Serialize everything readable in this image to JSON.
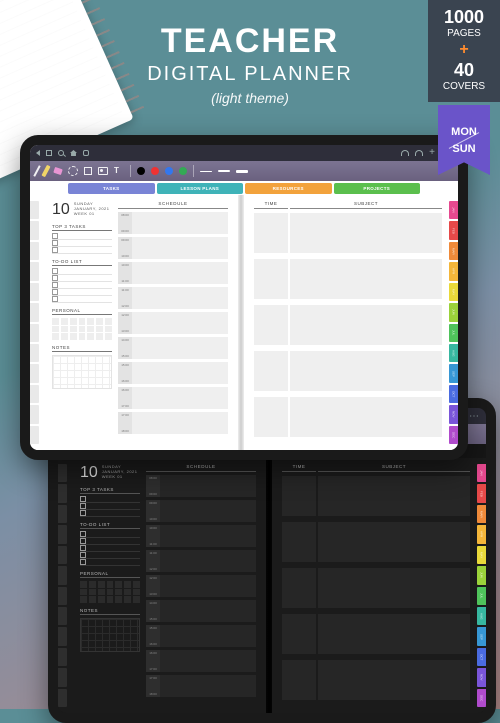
{
  "title": {
    "main": "TEACHER",
    "sub": "DIGITAL PLANNER",
    "theme": "(light theme)"
  },
  "corner": {
    "pages_count": "1000",
    "pages_label": "PAGES",
    "plus": "+",
    "covers_count": "40",
    "covers_label": "COVERS"
  },
  "pennant": {
    "top": "MON",
    "bottom": "SUN"
  },
  "navtabs": [
    {
      "label": "TASKS",
      "color": "#7984d6"
    },
    {
      "label": "LESSON PLANS",
      "color": "#3fb3b8"
    },
    {
      "label": "RESOURCES",
      "color": "#f2a23c"
    },
    {
      "label": "PROJECTS",
      "color": "#5bbf4d"
    }
  ],
  "left_page": {
    "day_number": "10",
    "weekday": "SUNDAY",
    "date_line": "JANUARY, 2021",
    "week_line": "WEEK 01",
    "sections": {
      "top3": "TOP 3 TASKS",
      "todo": "TO-DO LIST",
      "personal": "PERSONAL",
      "notes": "NOTES"
    },
    "schedule_header": "SCHEDULE",
    "schedule_rows": [
      {
        "from": "08:00",
        "to": "09:00"
      },
      {
        "from": "09:00",
        "to": "10:00"
      },
      {
        "from": "10:00",
        "to": "11:00"
      },
      {
        "from": "11:00",
        "to": "12:00"
      },
      {
        "from": "12:00",
        "to": "13:00"
      },
      {
        "from": "14:00",
        "to": "15:00"
      },
      {
        "from": "15:00",
        "to": "16:00"
      },
      {
        "from": "16:00",
        "to": "17:00"
      },
      {
        "from": "17:00",
        "to": "18:00"
      }
    ]
  },
  "right_page": {
    "col1": "TIME",
    "col2": "SUBJECT",
    "row_count": 5
  },
  "side_tabs_right": [
    {
      "label": "JAN",
      "color": "#e6498f"
    },
    {
      "label": "FEB",
      "color": "#e64949"
    },
    {
      "label": "MAR",
      "color": "#ef8a3a"
    },
    {
      "label": "APR",
      "color": "#f4b63a"
    },
    {
      "label": "MAY",
      "color": "#e9d93a"
    },
    {
      "label": "JUN",
      "color": "#9bd23a"
    },
    {
      "label": "JUL",
      "color": "#4fc35b"
    },
    {
      "label": "AUG",
      "color": "#37b7a0"
    },
    {
      "label": "SEP",
      "color": "#3797d4"
    },
    {
      "label": "OCT",
      "color": "#4a6be0"
    },
    {
      "label": "NOV",
      "color": "#7a55d9"
    },
    {
      "label": "DEC",
      "color": "#b04bcc"
    }
  ],
  "side_tabs_left_count": 12
}
